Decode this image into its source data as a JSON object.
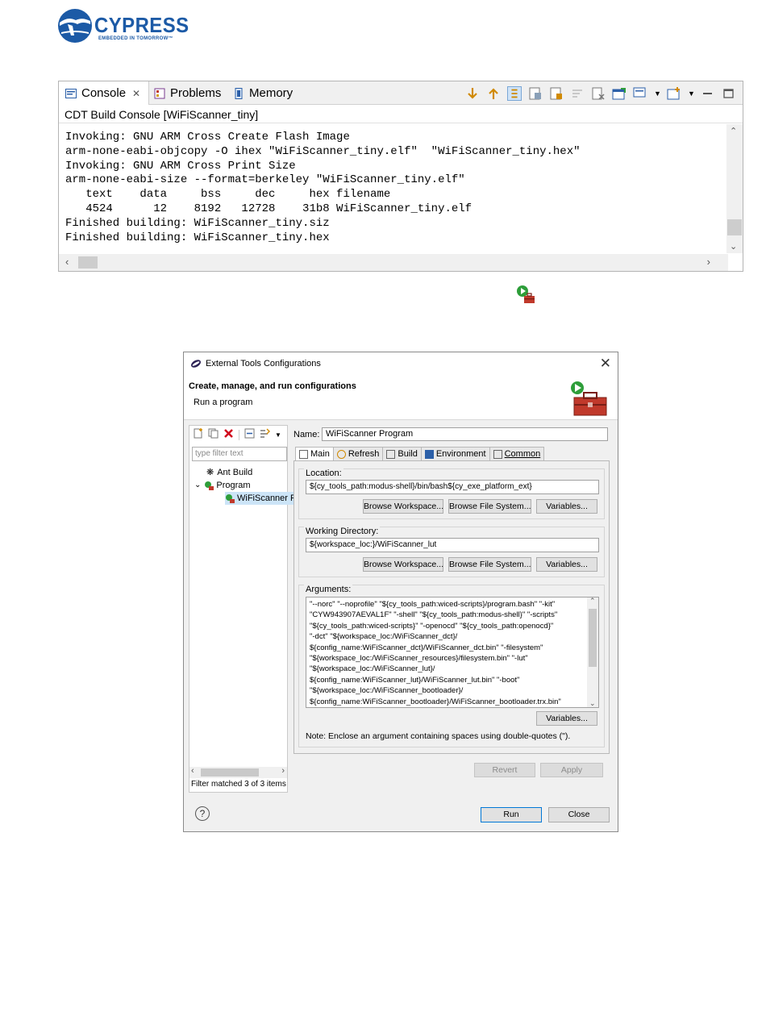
{
  "logo": {
    "word": "CYPRESS",
    "tagline": "EMBEDDED IN TOMORROW™"
  },
  "console": {
    "tabs": [
      {
        "label": "Console",
        "icon": "console-icon"
      },
      {
        "label": "Problems",
        "icon": "problems-icon"
      },
      {
        "label": "Memory",
        "icon": "memory-icon"
      }
    ],
    "close_glyph": "✕",
    "subtitle": "CDT Build Console [WiFiScanner_tiny]",
    "lines": [
      "Invoking: GNU ARM Cross Create Flash Image",
      "arm-none-eabi-objcopy -O ihex \"WiFiScanner_tiny.elf\"  \"WiFiScanner_tiny.hex\"",
      "Invoking: GNU ARM Cross Print Size",
      "arm-none-eabi-size --format=berkeley \"WiFiScanner_tiny.elf\"",
      "   text    data     bss     dec     hex filename",
      "   4524      12    8192   12728    31b8 WiFiScanner_tiny.elf",
      "Finished building: WiFiScanner_tiny.siz",
      "Finished building: WiFiScanner_tiny.hex"
    ]
  },
  "dialog": {
    "title": "External Tools Configurations",
    "close_glyph": "✕",
    "heading": "Create, manage, and run configurations",
    "subheading": "Run a program",
    "filter_placeholder": "type filter text",
    "tree": [
      {
        "label": "Ant Build"
      },
      {
        "label": "Program"
      },
      {
        "label": "WiFiScanner P"
      }
    ],
    "filter_status": "Filter matched 3 of 3 items",
    "name_label": "Name:",
    "name_value": "WiFiScanner Program",
    "tabs": [
      "Main",
      "Refresh",
      "Build",
      "Environment",
      "Common"
    ],
    "location": {
      "label": "Location:",
      "value": "${cy_tools_path:modus-shell}/bin/bash${cy_exe_platform_ext}",
      "buttons": [
        "Browse Workspace...",
        "Browse File System...",
        "Variables..."
      ]
    },
    "working_dir": {
      "label": "Working Directory:",
      "value": "${workspace_loc:}/WiFiScanner_lut",
      "buttons": [
        "Browse Workspace...",
        "Browse File System...",
        "Variables..."
      ]
    },
    "arguments": {
      "label": "Arguments:",
      "lines": [
        "\"--norc\" \"--noprofile\" \"${cy_tools_path:wiced-scripts}/program.bash\" \"-kit\"",
        "\"CYW943907AEVAL1F\" \"-shell\" \"${cy_tools_path:modus-shell}\" \"-scripts\"",
        "\"${cy_tools_path:wiced-scripts}\" \"-openocd\" \"${cy_tools_path:openocd}\"",
        "\"-dct\" \"${workspace_loc:/WiFiScanner_dct}/",
        "${config_name:WiFiScanner_dct}/WiFiScanner_dct.bin\" \"-filesystem\"",
        "\"${workspace_loc:/WiFiScanner_resources}/filesystem.bin\" \"-lut\"",
        "\"${workspace_loc:/WiFiScanner_lut}/",
        "${config_name:WiFiScanner_lut}/WiFiScanner_lut.bin\" \"-boot\"",
        "\"${workspace_loc:/WiFiScanner_bootloader}/",
        "${config_name:WiFiScanner_bootloader}/WiFiScanner_bootloader.trx.bin\""
      ],
      "variables_button": "Variables...",
      "note": "Note: Enclose an argument containing spaces using double-quotes (\")."
    },
    "revert_button": "Revert",
    "apply_button": "Apply",
    "run_button": "Run",
    "close_button": "Close",
    "help_glyph": "?"
  }
}
